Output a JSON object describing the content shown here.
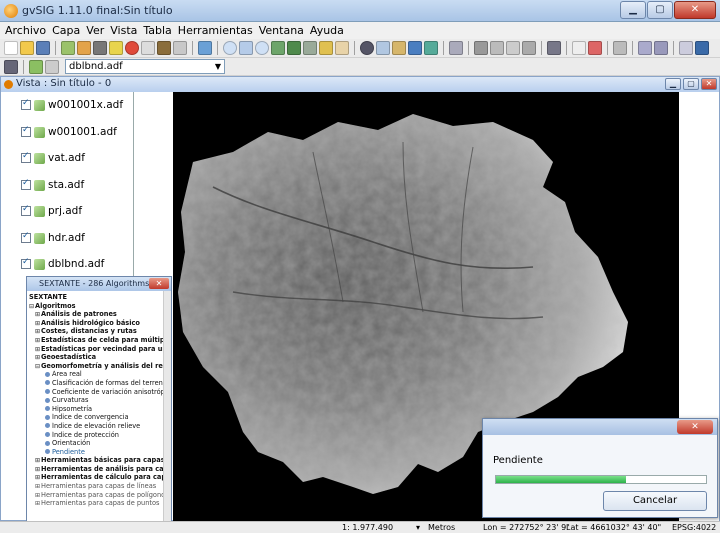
{
  "window": {
    "title": "gvSIG 1.11.0 final:Sin título"
  },
  "menu": [
    "Archivo",
    "Capa",
    "Ver",
    "Vista",
    "Tabla",
    "Herramientas",
    "Ventana",
    "Ayuda"
  ],
  "layer_selector": {
    "value": "dblbnd.adf"
  },
  "view": {
    "title": "Vista : Sin título - 0"
  },
  "toc": {
    "layers": [
      "w001001x.adf",
      "w001001.adf",
      "vat.adf",
      "sta.adf",
      "prj.adf",
      "hdr.adf",
      "dblbnd.adf"
    ]
  },
  "sextante": {
    "title": "SEXTANTE - 286 Algorithms",
    "root": "SEXTANTE",
    "algorithms_label": "Algoritmos",
    "groups_top": [
      "Análisis de patrones",
      "Análisis hidrológico básico",
      "Costes, distancias y rutas",
      "Estadísticas de celda para múltiples capas raster",
      "Estadísticas por vecindad para una capa raster",
      "Geoestadística"
    ],
    "expanded_group": "Geomorfometría y análisis del relieve",
    "expanded_items": [
      "Área real",
      "Clasificación de formas del terreno",
      "Coeficiente de variación anisotrópica",
      "Curvaturas",
      "Hipsometría",
      "Índice de convergencia",
      "Índice de elevación relieve",
      "Índice de protección",
      "Orientación",
      "Pendiente"
    ],
    "selected_item": "Pendiente",
    "groups_bottom": [
      "Herramientas básicas para capas raster",
      "Herramientas de análisis para capas raster",
      "Herramientas de cálculo para capas raster",
      "Herramientas para capas de líneas",
      "Herramientas para capas de polígonos",
      "Herramientas para capas de puntos"
    ]
  },
  "progress": {
    "label": "Pendiente",
    "fraction": 0.62,
    "cancel_label": "Cancelar"
  },
  "statusbar": {
    "scale": "1: 1.977.490",
    "units": "Metros",
    "lon": "Lon = 272752° 23' 9\"",
    "lat": "Lat = 4661032° 43' 40\"",
    "epsg": "EPSG:4022"
  },
  "colors": {
    "map_bg": "#000000",
    "progress_fill": "#2cb24a",
    "titlebar": "#a9c4e6"
  },
  "icons": [
    "new-icon",
    "open-icon",
    "save-icon",
    "zoom-in-icon",
    "zoom-out-icon",
    "pan-icon",
    "info-icon",
    "select-icon",
    "print-icon"
  ]
}
